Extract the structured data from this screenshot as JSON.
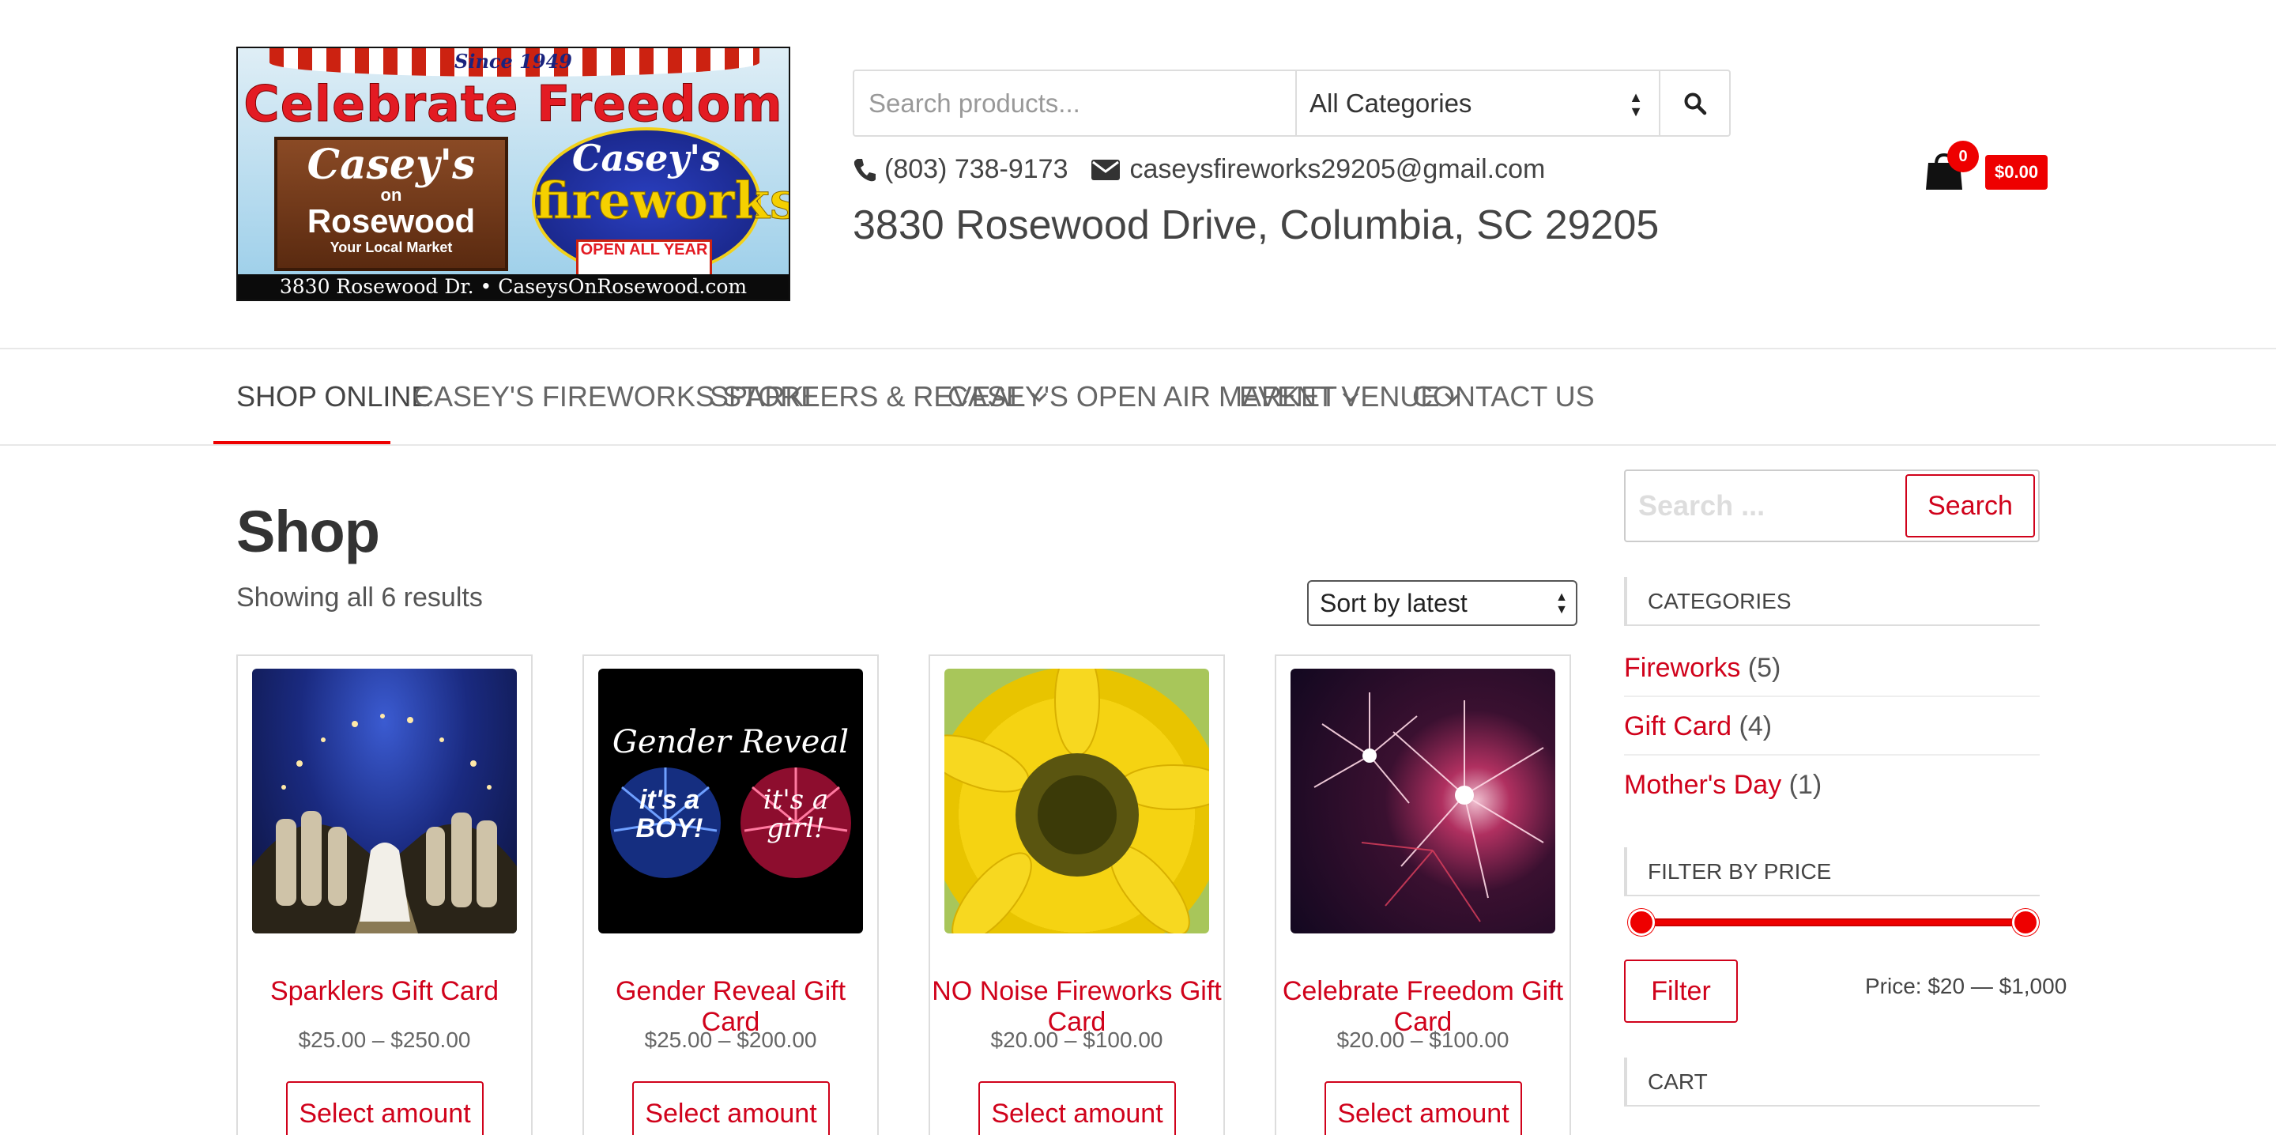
{
  "header": {
    "logo": {
      "since": "Since 1949",
      "headline": "Celebrate Freedom",
      "rosewood_line1": "Casey's",
      "rosewood_line2": "on",
      "rosewood_line3": "Rosewood",
      "rosewood_line4": "Your Local Market",
      "fireworks_line1": "Casey's",
      "fireworks_line2": "fireworks",
      "badge": "OPEN ALL YEAR",
      "bottom_bar": "3830 Rosewood Dr. • CaseysOnRosewood.com"
    },
    "search": {
      "placeholder": "Search products...",
      "category_selected": "All Categories"
    },
    "phone": "(803) 738-9173",
    "email": "caseysfireworks29205@gmail.com",
    "address": "3830 Rosewood Drive, Columbia, SC 29205",
    "cart": {
      "count": "0",
      "total": "$0.00"
    }
  },
  "nav": {
    "items": [
      {
        "label": "SHOP ONLINE",
        "active": true
      },
      {
        "label": "CASEY'S FIREWORKS STORE"
      },
      {
        "label": "SPARKLERS & REVEAL",
        "dropdown": true
      },
      {
        "label": "CASEY'S OPEN AIR MARKET",
        "dropdown": true
      },
      {
        "label": "EVENT VENUE",
        "dropdown": true
      },
      {
        "label": "CONTACT US"
      }
    ]
  },
  "main": {
    "title": "Shop",
    "results_text": "Showing all 6 results",
    "sort_selected": "Sort by latest",
    "products": [
      {
        "title": "Sparklers Gift Card",
        "price": "$25.00 – $250.00",
        "button": "Select amount"
      },
      {
        "title": "Gender Reveal Gift Card",
        "price": "$25.00 – $200.00",
        "button": "Select amount",
        "image_text": {
          "title": "Gender Reveal",
          "left": "it's a BOY!",
          "right": "it's a girl!"
        }
      },
      {
        "title": "NO Noise Fireworks Gift Card",
        "price": "$20.00 – $100.00",
        "button": "Select amount"
      },
      {
        "title": "Celebrate Freedom Gift Card",
        "price": "$20.00 – $100.00",
        "button": "Select amount"
      }
    ]
  },
  "sidebar": {
    "search_placeholder": "Search ...",
    "search_button": "Search",
    "categories_title": "CATEGORIES",
    "categories": [
      {
        "name": "Fireworks",
        "count": "(5)"
      },
      {
        "name": "Gift Card",
        "count": "(4)"
      },
      {
        "name": "Mother's Day",
        "count": "(1)"
      }
    ],
    "filter_title": "FILTER BY PRICE",
    "filter_button": "Filter",
    "price_label": "Price: $20 — $1,000",
    "price_min": 20,
    "price_max": 1000,
    "cart_title": "CART"
  },
  "colors": {
    "accent": "#d0021b",
    "cart_badge": "#ee0000"
  }
}
